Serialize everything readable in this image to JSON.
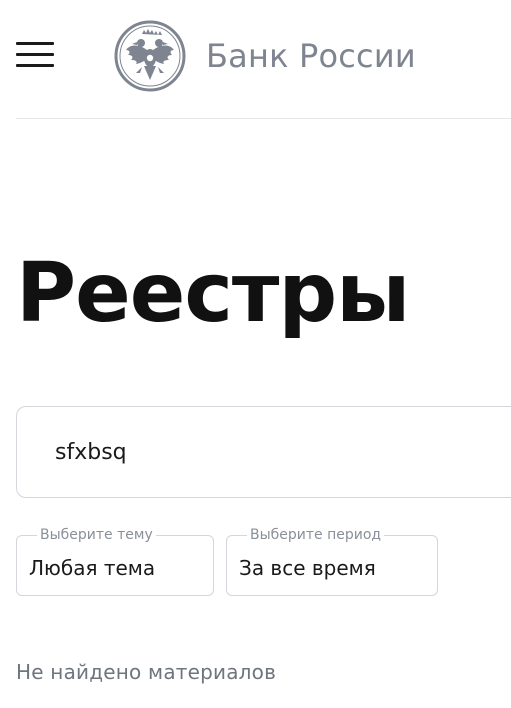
{
  "header": {
    "logo_text": "Банк России",
    "colors": {
      "logo": "#7e8590",
      "divider": "#e4e6ea"
    },
    "icons": {
      "menu": "hamburger-menu-icon",
      "emblem": "double-headed-eagle-emblem"
    }
  },
  "main": {
    "title": "Реестры",
    "search": {
      "value": "sfxbsq"
    },
    "filters": [
      {
        "legend": "Выберите тему",
        "value": "Любая тема"
      },
      {
        "legend": "Выберите период",
        "value": "За все время"
      }
    ],
    "empty_message": "Не найдено материалов"
  }
}
